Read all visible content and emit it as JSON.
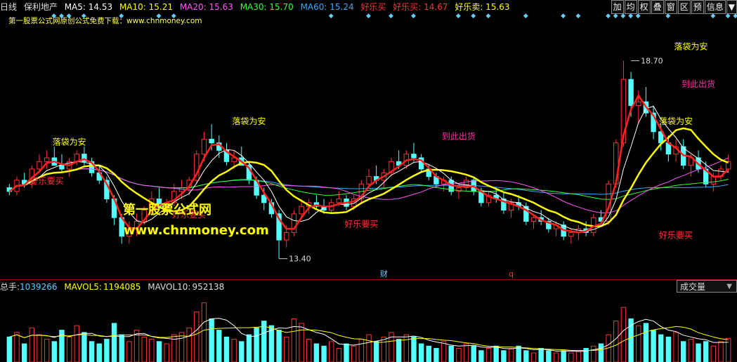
{
  "header": {
    "period": "日线",
    "stock_name": "保利地产",
    "items": [
      {
        "label": "MA5: 14.53",
        "color": "#ffffff"
      },
      {
        "label": "MA10: 15.21",
        "color": "#ffff00"
      },
      {
        "label": "MA20: 15.63",
        "color": "#ff55ff"
      },
      {
        "label": "MA30: 15.70",
        "color": "#33ff33"
      },
      {
        "label": "MA60: 15.24",
        "color": "#33aaff"
      },
      {
        "label": "好乐买",
        "color": "#ff3333"
      },
      {
        "label": "好乐买: 14.67",
        "color": "#ff3333"
      },
      {
        "label": "好乐卖: 15.63",
        "color": "#ffff00"
      }
    ],
    "toolbar": [
      "加",
      "均",
      "权",
      "叠",
      "窗",
      "区",
      "预",
      "信息",
      "▼"
    ]
  },
  "subtitle": "第一股票公式网原创公式免费下载：www.chnmoney.com",
  "diamond_icon": "diamond-icon",
  "chart_data": {
    "type": "candlestick",
    "price_range": [
      13.0,
      19.5
    ],
    "candles": [
      [
        15.3,
        15.4,
        15.1,
        15.2
      ],
      [
        15.2,
        15.6,
        15.1,
        15.5
      ],
      [
        15.5,
        15.7,
        15.3,
        15.4
      ],
      [
        15.4,
        15.9,
        15.3,
        15.8
      ],
      [
        15.8,
        16.2,
        15.7,
        16.0
      ],
      [
        16.0,
        16.3,
        15.8,
        16.1
      ],
      [
        16.1,
        16.4,
        15.9,
        15.9
      ],
      [
        15.9,
        16.2,
        15.7,
        15.8
      ],
      [
        15.8,
        16.1,
        15.6,
        16.0
      ],
      [
        16.0,
        16.3,
        15.9,
        16.2
      ],
      [
        16.2,
        16.4,
        15.9,
        16.0
      ],
      [
        16.0,
        16.1,
        15.6,
        15.7
      ],
      [
        15.7,
        15.9,
        15.4,
        15.5
      ],
      [
        15.5,
        15.6,
        14.9,
        15.0
      ],
      [
        15.0,
        15.1,
        14.3,
        14.5
      ],
      [
        14.5,
        14.6,
        13.8,
        14.0
      ],
      [
        14.0,
        14.4,
        13.8,
        14.2
      ],
      [
        14.2,
        14.6,
        14.0,
        14.4
      ],
      [
        14.4,
        14.8,
        14.3,
        14.7
      ],
      [
        14.7,
        15.2,
        14.6,
        15.0
      ],
      [
        15.0,
        15.3,
        14.7,
        14.8
      ],
      [
        14.8,
        15.0,
        14.6,
        14.9
      ],
      [
        14.9,
        15.4,
        14.8,
        15.2
      ],
      [
        15.2,
        15.5,
        15.0,
        15.3
      ],
      [
        15.3,
        15.6,
        15.1,
        15.5
      ],
      [
        15.5,
        16.3,
        15.4,
        16.2
      ],
      [
        16.2,
        16.8,
        16.0,
        16.6
      ],
      [
        16.6,
        17.0,
        16.3,
        16.5
      ],
      [
        16.5,
        16.7,
        16.1,
        16.3
      ],
      [
        16.3,
        16.5,
        15.9,
        16.0
      ],
      [
        16.0,
        16.3,
        15.8,
        16.1
      ],
      [
        16.1,
        16.4,
        15.9,
        15.9
      ],
      [
        15.9,
        16.0,
        15.4,
        15.5
      ],
      [
        15.5,
        15.6,
        15.0,
        15.1
      ],
      [
        15.1,
        15.3,
        14.7,
        14.9
      ],
      [
        14.9,
        15.0,
        14.5,
        14.6
      ],
      [
        14.6,
        14.7,
        13.4,
        13.9
      ],
      [
        13.9,
        14.3,
        13.7,
        14.1
      ],
      [
        14.1,
        14.7,
        14.0,
        14.6
      ],
      [
        14.6,
        15.0,
        14.5,
        14.8
      ],
      [
        14.8,
        15.0,
        14.6,
        14.9
      ],
      [
        14.9,
        15.1,
        14.7,
        14.8
      ],
      [
        14.8,
        15.0,
        14.6,
        14.7
      ],
      [
        14.7,
        15.0,
        14.6,
        14.9
      ],
      [
        14.9,
        15.2,
        14.8,
        15.0
      ],
      [
        15.0,
        15.1,
        14.7,
        14.8
      ],
      [
        14.8,
        15.1,
        14.7,
        15.0
      ],
      [
        15.0,
        15.5,
        14.9,
        15.4
      ],
      [
        15.4,
        15.8,
        15.3,
        15.6
      ],
      [
        15.6,
        15.9,
        15.4,
        15.5
      ],
      [
        15.5,
        15.8,
        15.3,
        15.7
      ],
      [
        15.7,
        16.1,
        15.6,
        16.0
      ],
      [
        16.0,
        16.3,
        15.8,
        15.9
      ],
      [
        15.9,
        16.3,
        15.8,
        16.2
      ],
      [
        16.2,
        16.5,
        16.0,
        16.1
      ],
      [
        16.1,
        16.2,
        15.7,
        15.8
      ],
      [
        15.8,
        15.9,
        15.5,
        15.6
      ],
      [
        15.6,
        15.7,
        15.3,
        15.4
      ],
      [
        15.4,
        15.6,
        15.2,
        15.5
      ],
      [
        15.5,
        15.6,
        15.1,
        15.2
      ],
      [
        15.2,
        15.4,
        15.0,
        15.3
      ],
      [
        15.3,
        15.6,
        15.2,
        15.5
      ],
      [
        15.5,
        15.6,
        15.1,
        15.2
      ],
      [
        15.2,
        15.3,
        14.8,
        14.9
      ],
      [
        14.9,
        15.2,
        14.8,
        15.1
      ],
      [
        15.1,
        15.3,
        14.9,
        15.0
      ],
      [
        15.0,
        15.2,
        14.6,
        14.7
      ],
      [
        14.7,
        15.0,
        14.5,
        14.9
      ],
      [
        14.9,
        15.1,
        14.7,
        14.8
      ],
      [
        14.8,
        14.9,
        14.3,
        14.4
      ],
      [
        14.4,
        14.6,
        14.2,
        14.5
      ],
      [
        14.5,
        14.7,
        14.3,
        14.4
      ],
      [
        14.4,
        14.5,
        14.1,
        14.2
      ],
      [
        14.2,
        14.4,
        14.0,
        14.3
      ],
      [
        14.3,
        14.4,
        13.9,
        14.0
      ],
      [
        14.0,
        14.2,
        13.8,
        14.1
      ],
      [
        14.1,
        14.3,
        13.9,
        14.2
      ],
      [
        14.2,
        14.4,
        14.0,
        14.1
      ],
      [
        14.1,
        14.6,
        14.0,
        14.5
      ],
      [
        14.5,
        14.7,
        14.3,
        14.4
      ],
      [
        14.4,
        15.5,
        14.3,
        15.4
      ],
      [
        15.4,
        16.6,
        15.3,
        16.5
      ],
      [
        16.5,
        18.7,
        16.4,
        18.2
      ],
      [
        18.2,
        18.4,
        17.2,
        17.5
      ],
      [
        17.5,
        17.9,
        17.0,
        17.6
      ],
      [
        17.6,
        18.0,
        17.2,
        17.3
      ],
      [
        17.3,
        17.5,
        16.6,
        16.8
      ],
      [
        16.8,
        17.0,
        16.3,
        16.5
      ],
      [
        16.5,
        16.7,
        16.0,
        16.2
      ],
      [
        16.2,
        16.6,
        16.0,
        16.4
      ],
      [
        16.4,
        16.6,
        15.8,
        15.9
      ],
      [
        15.9,
        16.2,
        15.6,
        16.1
      ],
      [
        16.1,
        16.3,
        15.7,
        15.8
      ],
      [
        15.8,
        16.0,
        15.3,
        15.4
      ],
      [
        15.4,
        15.7,
        15.2,
        15.6
      ],
      [
        15.6,
        15.9,
        15.5,
        15.8
      ],
      [
        15.8,
        16.2,
        15.7,
        16.0
      ]
    ],
    "volumes": [
      1.1,
      1.3,
      0.8,
      1.5,
      1.2,
      1.0,
      0.9,
      1.4,
      1.1,
      1.6,
      1.3,
      0.9,
      0.8,
      1.0,
      1.7,
      1.2,
      0.9,
      1.4,
      1.1,
      1.0,
      0.9,
      0.8,
      1.2,
      1.3,
      1.5,
      2.2,
      2.6,
      1.9,
      1.4,
      1.1,
      1.0,
      0.9,
      1.2,
      1.5,
      1.8,
      1.6,
      1.4,
      1.1,
      1.9,
      1.7,
      1.0,
      0.8,
      0.7,
      0.9,
      0.6,
      0.8,
      0.7,
      1.0,
      1.2,
      0.9,
      1.1,
      1.3,
      1.0,
      1.2,
      1.1,
      0.8,
      0.7,
      0.6,
      0.9,
      0.7,
      0.6,
      0.8,
      0.7,
      0.5,
      0.6,
      0.7,
      0.5,
      0.6,
      0.7,
      0.5,
      0.4,
      0.6,
      0.5,
      0.4,
      0.5,
      0.4,
      0.5,
      0.6,
      0.7,
      0.8,
      1.2,
      1.8,
      2.4,
      1.9,
      1.6,
      1.7,
      1.4,
      1.2,
      1.1,
      1.3,
      0.9,
      1.0,
      0.8,
      0.9,
      0.7,
      0.9,
      1.04
    ],
    "volume_range": [
      0,
      2.9
    ],
    "annotations": [
      {
        "text": "落袋为安",
        "i": 8,
        "price": 16.45,
        "color": "#ffff00"
      },
      {
        "text": "好乐要买",
        "i": 5,
        "price": 15.4,
        "color": "#ff3333"
      },
      {
        "text": "好乐要买",
        "i": 24,
        "price": 14.5,
        "color": "#ff3333"
      },
      {
        "text": "落袋为安",
        "i": 32,
        "price": 17.0,
        "color": "#ffff00"
      },
      {
        "text": "到此出货",
        "i": 60,
        "price": 16.6,
        "color": "#ff33aa"
      },
      {
        "text": "好乐要买",
        "i": 47,
        "price": 14.25,
        "color": "#ff3333"
      },
      {
        "text": "好乐要买",
        "i": 89,
        "price": 13.95,
        "color": "#ff3333"
      },
      {
        "text": "落袋为安",
        "i": 91,
        "price": 19.0,
        "color": "#ffff00"
      },
      {
        "text": "到此出货",
        "i": 92,
        "price": 18.0,
        "color": "#ff33aa"
      },
      {
        "text": "落袋为安",
        "i": 89,
        "price": 17.0,
        "color": "#ffff00"
      }
    ],
    "price_labels": [
      {
        "text": "18.70",
        "i": 83,
        "price": 18.7
      },
      {
        "text": "13.40",
        "i": 36,
        "price": 13.4
      }
    ],
    "markers": [
      {
        "text": "财",
        "i": 50,
        "color": "#5ecfff"
      },
      {
        "text": "q",
        "i": 67,
        "color": "#ff3333"
      }
    ]
  },
  "volume_header": {
    "label_total": "总手:",
    "total_value": "1039266",
    "mavol5_label": "MAVOL5:",
    "mavol5_value": "1194085",
    "mavol10_label": "MAVOL10:",
    "mavol10_value": "952138"
  },
  "volume_selector": "成交量",
  "watermark": {
    "line1": "第一股票公式网",
    "line2": "www.chnmoney.com"
  }
}
